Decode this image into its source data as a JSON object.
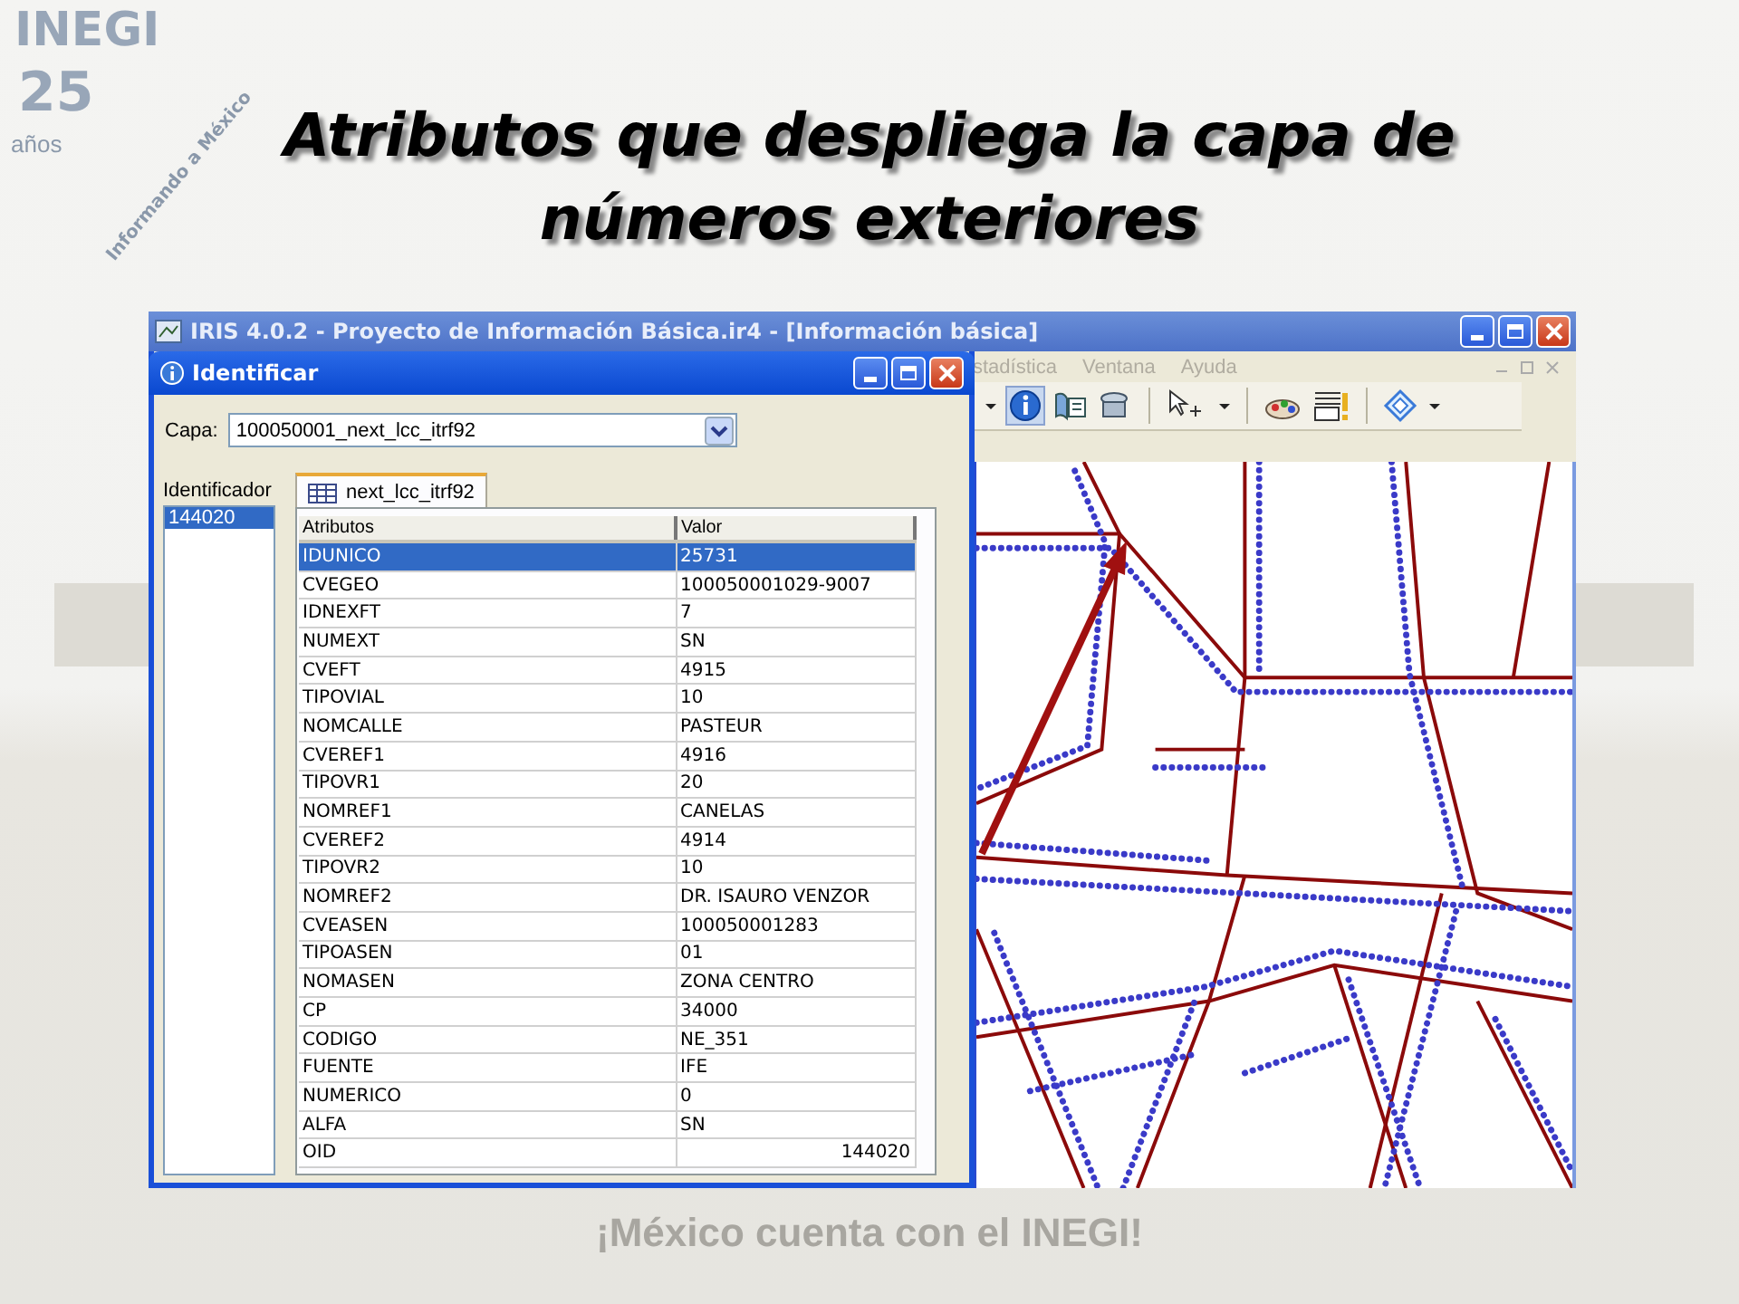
{
  "slide": {
    "title_lines": [
      "Atributos que despliega la capa de",
      "números exteriores"
    ],
    "footer": "¡México cuenta con el INEGI!",
    "logo": {
      "name": "INEGI",
      "years": "25",
      "years_label": "años",
      "tagline": "Informando a México"
    }
  },
  "app_window": {
    "title": "IRIS 4.0.2 - Proyecto de Información Básica.ir4 - [Información básica]",
    "menu": [
      "stadística",
      "Ventana",
      "Ayuda"
    ]
  },
  "dialog": {
    "title": "Identificar",
    "layer_label": "Capa:",
    "layer_value": "100050001_next_lcc_itrf92",
    "identifier_label": "Identificador",
    "identifiers": [
      {
        "label": "144020",
        "selected": true
      }
    ],
    "tabs": [
      {
        "label": "next_lcc_itrf92",
        "selected": true
      }
    ],
    "table": {
      "columns": [
        "Atributos",
        "Valor"
      ],
      "rows": [
        {
          "attribute": "IDUNICO",
          "value": "25731",
          "kind": "text",
          "selected": true
        },
        {
          "attribute": "CVEGEO",
          "value": "100050001029-9007",
          "kind": "text",
          "selected": false
        },
        {
          "attribute": "IDNEXFT",
          "value": "7",
          "kind": "text",
          "selected": false
        },
        {
          "attribute": "NUMEXT",
          "value": "SN",
          "kind": "text",
          "selected": false
        },
        {
          "attribute": "CVEFT",
          "value": "4915",
          "kind": "text",
          "selected": false
        },
        {
          "attribute": "TIPOVIAL",
          "value": "10",
          "kind": "text",
          "selected": false
        },
        {
          "attribute": "NOMCALLE",
          "value": "PASTEUR",
          "kind": "text",
          "selected": false
        },
        {
          "attribute": "CVEREF1",
          "value": "4916",
          "kind": "text",
          "selected": false
        },
        {
          "attribute": "TIPOVR1",
          "value": "20",
          "kind": "text",
          "selected": false
        },
        {
          "attribute": "NOMREF1",
          "value": "CANELAS",
          "kind": "text",
          "selected": false
        },
        {
          "attribute": "CVEREF2",
          "value": "4914",
          "kind": "text",
          "selected": false
        },
        {
          "attribute": "TIPOVR2",
          "value": "10",
          "kind": "text",
          "selected": false
        },
        {
          "attribute": "NOMREF2",
          "value": "DR. ISAURO VENZOR",
          "kind": "text",
          "selected": false
        },
        {
          "attribute": "CVEASEN",
          "value": "100050001283",
          "kind": "text",
          "selected": false
        },
        {
          "attribute": "TIPOASEN",
          "value": "01",
          "kind": "text",
          "selected": false
        },
        {
          "attribute": "NOMASEN",
          "value": "ZONA CENTRO",
          "kind": "text",
          "selected": false
        },
        {
          "attribute": "CP",
          "value": "34000",
          "kind": "text",
          "selected": false
        },
        {
          "attribute": "CODIGO",
          "value": "NE_351",
          "kind": "text",
          "selected": false
        },
        {
          "attribute": "FUENTE",
          "value": "IFE",
          "kind": "text",
          "selected": false
        },
        {
          "attribute": "NUMERICO",
          "value": "0",
          "kind": "text",
          "selected": false
        },
        {
          "attribute": "ALFA",
          "value": "SN",
          "kind": "text",
          "selected": false
        },
        {
          "attribute": "OID",
          "value": "144020",
          "kind": "number",
          "selected": false
        }
      ]
    }
  }
}
